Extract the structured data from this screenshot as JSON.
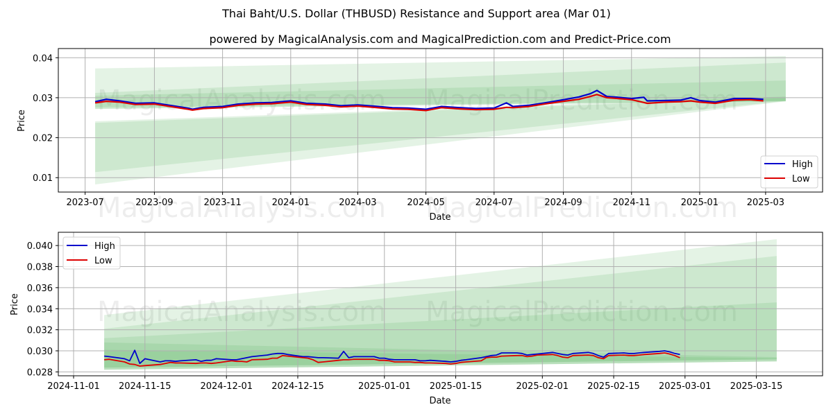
{
  "figure": {
    "title": "Thai Baht/U.S. Dollar (THBUSD) Resistance and Support area (Mar 01)",
    "subtitle": "powered by MagicalAnalysis.com and MagicalPrediction.com and Predict-Price.com",
    "watermarks": [
      "MagicalAnalysis.com",
      "MagicalPrediction.com"
    ]
  },
  "colors": {
    "high": "#0000cc",
    "low": "#dd0000",
    "band": "#4caf50",
    "grid": "#b0b0b0"
  },
  "chart_data": [
    {
      "type": "line",
      "title": "",
      "xlabel": "Date",
      "ylabel": "Price",
      "x_ticks": [
        "2023-07",
        "2023-09",
        "2023-11",
        "2024-01",
        "2024-03",
        "2024-05",
        "2024-07",
        "2024-09",
        "2024-11",
        "2025-01",
        "2025-03"
      ],
      "x_tick_dates": [
        "2023-07-01",
        "2023-09-01",
        "2023-11-01",
        "2024-01-01",
        "2024-03-01",
        "2024-05-01",
        "2024-07-01",
        "2024-09-01",
        "2024-11-01",
        "2025-01-01",
        "2025-03-01"
      ],
      "y_ticks": [
        "0.01",
        "0.02",
        "0.03",
        "0.04"
      ],
      "y_tick_values": [
        0.01,
        0.02,
        0.03,
        0.04
      ],
      "xlim": [
        "2023-06-07",
        "2025-04-21"
      ],
      "ylim": [
        0.0064,
        0.0423
      ],
      "grid": true,
      "legend": {
        "position": "lower-right",
        "entries": [
          "High",
          "Low"
        ]
      },
      "series": [
        {
          "name": "High",
          "x": [
            "2023-07-10",
            "2023-07-20",
            "2023-08-01",
            "2023-08-15",
            "2023-09-01",
            "2023-09-15",
            "2023-10-01",
            "2023-10-05",
            "2023-10-15",
            "2023-11-01",
            "2023-11-15",
            "2023-12-01",
            "2023-12-15",
            "2024-01-01",
            "2024-01-15",
            "2024-02-01",
            "2024-02-15",
            "2024-03-01",
            "2024-03-15",
            "2024-04-01",
            "2024-04-15",
            "2024-05-01",
            "2024-05-15",
            "2024-06-01",
            "2024-06-15",
            "2024-07-01",
            "2024-07-12",
            "2024-07-18",
            "2024-08-01",
            "2024-08-15",
            "2024-09-01",
            "2024-09-15",
            "2024-09-25",
            "2024-10-01",
            "2024-10-10",
            "2024-10-20",
            "2024-11-01",
            "2024-11-12",
            "2024-11-15",
            "2024-12-01",
            "2024-12-15",
            "2024-12-24",
            "2025-01-01",
            "2025-01-15",
            "2025-02-01",
            "2025-02-15",
            "2025-02-27"
          ],
          "values": [
            0.029,
            0.0296,
            0.0292,
            0.0286,
            0.0287,
            0.0281,
            0.0274,
            0.0271,
            0.0276,
            0.0278,
            0.0284,
            0.0287,
            0.0288,
            0.0292,
            0.0286,
            0.0284,
            0.028,
            0.0282,
            0.0279,
            0.0275,
            0.0274,
            0.0271,
            0.0278,
            0.0275,
            0.0273,
            0.0274,
            0.0287,
            0.0278,
            0.0281,
            0.0287,
            0.0295,
            0.0302,
            0.031,
            0.0318,
            0.0303,
            0.0301,
            0.0298,
            0.0301,
            0.0292,
            0.0293,
            0.0294,
            0.03,
            0.0293,
            0.0289,
            0.0298,
            0.0298,
            0.0296
          ]
        },
        {
          "name": "Low",
          "x": [
            "2023-07-10",
            "2023-07-20",
            "2023-08-01",
            "2023-08-15",
            "2023-09-01",
            "2023-09-15",
            "2023-10-01",
            "2023-10-05",
            "2023-10-15",
            "2023-11-01",
            "2023-11-15",
            "2023-12-01",
            "2023-12-15",
            "2024-01-01",
            "2024-01-15",
            "2024-02-01",
            "2024-02-15",
            "2024-03-01",
            "2024-03-15",
            "2024-04-01",
            "2024-04-15",
            "2024-05-01",
            "2024-05-15",
            "2024-06-01",
            "2024-06-15",
            "2024-07-01",
            "2024-07-12",
            "2024-07-18",
            "2024-08-01",
            "2024-08-15",
            "2024-09-01",
            "2024-09-15",
            "2024-09-25",
            "2024-10-01",
            "2024-10-10",
            "2024-10-20",
            "2024-11-01",
            "2024-11-12",
            "2024-11-15",
            "2024-12-01",
            "2024-12-15",
            "2024-12-24",
            "2025-01-01",
            "2025-01-15",
            "2025-02-01",
            "2025-02-15",
            "2025-02-27"
          ],
          "values": [
            0.0287,
            0.0291,
            0.0289,
            0.0283,
            0.0284,
            0.0278,
            0.0271,
            0.0269,
            0.0273,
            0.0275,
            0.0281,
            0.0284,
            0.0285,
            0.0289,
            0.0283,
            0.0281,
            0.0277,
            0.0279,
            0.0276,
            0.0272,
            0.0271,
            0.0268,
            0.0275,
            0.0272,
            0.027,
            0.0271,
            0.0276,
            0.0275,
            0.0278,
            0.0284,
            0.0291,
            0.0296,
            0.0303,
            0.0308,
            0.03,
            0.0298,
            0.0295,
            0.0288,
            0.0286,
            0.0289,
            0.029,
            0.0292,
            0.0289,
            0.0286,
            0.0294,
            0.0295,
            0.0292
          ]
        }
      ],
      "bands": [
        {
          "name": "resistance-outer",
          "x": [
            "2023-07-10",
            "2025-03-19"
          ],
          "upper": [
            0.0373,
            0.0404
          ],
          "lower": [
            0.0272,
            0.0291
          ],
          "opacity": 0.15
        },
        {
          "name": "resistance-mid",
          "x": [
            "2023-07-10",
            "2025-03-19"
          ],
          "upper": [
            0.0312,
            0.0388
          ],
          "lower": [
            0.0272,
            0.0291
          ],
          "opacity": 0.15
        },
        {
          "name": "resistance-inner",
          "x": [
            "2023-07-10",
            "2025-03-19"
          ],
          "upper": [
            0.0305,
            0.0343
          ],
          "lower": [
            0.0276,
            0.0292
          ],
          "opacity": 0.15
        },
        {
          "name": "support-outer",
          "x": [
            "2023-07-10",
            "2025-03-19"
          ],
          "upper": [
            0.0241,
            0.0303
          ],
          "lower": [
            0.0083,
            0.0291
          ],
          "opacity": 0.15
        },
        {
          "name": "support-inner",
          "x": [
            "2023-07-10",
            "2025-03-19"
          ],
          "upper": [
            0.0237,
            0.03
          ],
          "lower": [
            0.0114,
            0.0292
          ],
          "opacity": 0.15
        }
      ]
    },
    {
      "type": "line",
      "title": "",
      "xlabel": "Date",
      "ylabel": "Price",
      "x_ticks": [
        "2024-11-01",
        "2024-11-15",
        "2024-12-01",
        "2024-12-15",
        "2025-01-01",
        "2025-01-15",
        "2025-02-01",
        "2025-02-15",
        "2025-03-01",
        "2025-03-15"
      ],
      "x_tick_dates": [
        "2024-11-01",
        "2024-11-15",
        "2024-12-01",
        "2024-12-15",
        "2025-01-01",
        "2025-01-15",
        "2025-02-01",
        "2025-02-15",
        "2025-03-01",
        "2025-03-15"
      ],
      "y_ticks": [
        "0.028",
        "0.030",
        "0.032",
        "0.034",
        "0.036",
        "0.038",
        "0.040"
      ],
      "y_tick_values": [
        0.028,
        0.03,
        0.032,
        0.034,
        0.036,
        0.038,
        0.04
      ],
      "xlim": [
        "2024-10-29",
        "2025-03-28"
      ],
      "ylim": [
        0.02763,
        0.04126
      ],
      "grid": true,
      "legend": {
        "position": "upper-left",
        "entries": [
          "High",
          "Low"
        ]
      },
      "series": [
        {
          "name": "High",
          "x": [
            "2024-11-07",
            "2024-11-08",
            "2024-11-11",
            "2024-11-12",
            "2024-11-13",
            "2024-11-14",
            "2024-11-15",
            "2024-11-18",
            "2024-11-19",
            "2024-11-20",
            "2024-11-21",
            "2024-11-22",
            "2024-11-25",
            "2024-11-26",
            "2024-11-27",
            "2024-11-28",
            "2024-11-29",
            "2024-12-02",
            "2024-12-03",
            "2024-12-04",
            "2024-12-05",
            "2024-12-06",
            "2024-12-09",
            "2024-12-10",
            "2024-12-11",
            "2024-12-12",
            "2024-12-13",
            "2024-12-16",
            "2024-12-17",
            "2024-12-18",
            "2024-12-19",
            "2024-12-20",
            "2024-12-23",
            "2024-12-24",
            "2024-12-25",
            "2024-12-26",
            "2024-12-27",
            "2024-12-30",
            "2024-12-31",
            "2025-01-01",
            "2025-01-02",
            "2025-01-03",
            "2025-01-06",
            "2025-01-07",
            "2025-01-08",
            "2025-01-09",
            "2025-01-10",
            "2025-01-13",
            "2025-01-14",
            "2025-01-15",
            "2025-01-16",
            "2025-01-17",
            "2025-01-20",
            "2025-01-21",
            "2025-01-22",
            "2025-01-23",
            "2025-01-24",
            "2025-01-27",
            "2025-01-28",
            "2025-01-29",
            "2025-01-30",
            "2025-01-31",
            "2025-02-03",
            "2025-02-04",
            "2025-02-05",
            "2025-02-06",
            "2025-02-07",
            "2025-02-10",
            "2025-02-11",
            "2025-02-12",
            "2025-02-13",
            "2025-02-14",
            "2025-02-17",
            "2025-02-18",
            "2025-02-19",
            "2025-02-20",
            "2025-02-21",
            "2025-02-24",
            "2025-02-25",
            "2025-02-26",
            "2025-02-27",
            "2025-02-28"
          ],
          "values": [
            0.0295,
            0.02945,
            0.02925,
            0.02905,
            0.03005,
            0.0288,
            0.02925,
            0.02895,
            0.02905,
            0.02905,
            0.029,
            0.02905,
            0.02915,
            0.029,
            0.0291,
            0.0291,
            0.02925,
            0.02915,
            0.02915,
            0.02925,
            0.02935,
            0.02945,
            0.0296,
            0.0297,
            0.02975,
            0.02975,
            0.02965,
            0.02945,
            0.02945,
            0.0294,
            0.02935,
            0.02935,
            0.0293,
            0.02995,
            0.02935,
            0.02945,
            0.02945,
            0.02945,
            0.0293,
            0.0293,
            0.0292,
            0.02915,
            0.02915,
            0.02915,
            0.02905,
            0.02905,
            0.0291,
            0.029,
            0.02895,
            0.029,
            0.0291,
            0.02915,
            0.02935,
            0.02945,
            0.02955,
            0.0296,
            0.0298,
            0.0298,
            0.02975,
            0.0296,
            0.02965,
            0.0297,
            0.02985,
            0.02975,
            0.02965,
            0.0296,
            0.02975,
            0.02985,
            0.02975,
            0.02955,
            0.0294,
            0.02975,
            0.0298,
            0.02975,
            0.02975,
            0.0298,
            0.02985,
            0.02995,
            0.03,
            0.0299,
            0.02975,
            0.02965
          ]
        },
        {
          "name": "Low",
          "x": [
            "2024-11-07",
            "2024-11-08",
            "2024-11-11",
            "2024-11-12",
            "2024-11-13",
            "2024-11-14",
            "2024-11-15",
            "2024-11-18",
            "2024-11-19",
            "2024-11-20",
            "2024-11-21",
            "2024-11-22",
            "2024-11-25",
            "2024-11-26",
            "2024-11-27",
            "2024-11-28",
            "2024-11-29",
            "2024-12-02",
            "2024-12-03",
            "2024-12-04",
            "2024-12-05",
            "2024-12-06",
            "2024-12-09",
            "2024-12-10",
            "2024-12-11",
            "2024-12-12",
            "2024-12-13",
            "2024-12-16",
            "2024-12-17",
            "2024-12-18",
            "2024-12-19",
            "2024-12-20",
            "2024-12-23",
            "2024-12-24",
            "2024-12-25",
            "2024-12-26",
            "2024-12-27",
            "2024-12-30",
            "2024-12-31",
            "2025-01-01",
            "2025-01-02",
            "2025-01-03",
            "2025-01-06",
            "2025-01-07",
            "2025-01-08",
            "2025-01-09",
            "2025-01-10",
            "2025-01-13",
            "2025-01-14",
            "2025-01-15",
            "2025-01-16",
            "2025-01-17",
            "2025-01-20",
            "2025-01-21",
            "2025-01-22",
            "2025-01-23",
            "2025-01-24",
            "2025-01-27",
            "2025-01-28",
            "2025-01-29",
            "2025-01-30",
            "2025-01-31",
            "2025-02-03",
            "2025-02-04",
            "2025-02-05",
            "2025-02-06",
            "2025-02-07",
            "2025-02-10",
            "2025-02-11",
            "2025-02-12",
            "2025-02-13",
            "2025-02-14",
            "2025-02-17",
            "2025-02-18",
            "2025-02-19",
            "2025-02-20",
            "2025-02-21",
            "2025-02-24",
            "2025-02-25",
            "2025-02-26",
            "2025-02-27",
            "2025-02-28"
          ],
          "values": [
            0.02915,
            0.0292,
            0.02895,
            0.02875,
            0.0287,
            0.02855,
            0.0286,
            0.0287,
            0.0288,
            0.0289,
            0.02885,
            0.02885,
            0.0288,
            0.02885,
            0.02885,
            0.0288,
            0.02885,
            0.02905,
            0.029,
            0.029,
            0.02895,
            0.02915,
            0.0292,
            0.0293,
            0.0293,
            0.02955,
            0.0295,
            0.02935,
            0.0293,
            0.02915,
            0.0289,
            0.02895,
            0.0291,
            0.02915,
            0.02915,
            0.0292,
            0.0292,
            0.0292,
            0.0291,
            0.0291,
            0.02905,
            0.02895,
            0.02895,
            0.0289,
            0.0289,
            0.02885,
            0.02885,
            0.0288,
            0.02875,
            0.0288,
            0.0289,
            0.02895,
            0.02905,
            0.02935,
            0.0294,
            0.0294,
            0.0295,
            0.02955,
            0.02955,
            0.02945,
            0.0295,
            0.0296,
            0.02965,
            0.02955,
            0.0294,
            0.02935,
            0.02955,
            0.0296,
            0.02955,
            0.02935,
            0.02925,
            0.02955,
            0.0296,
            0.02955,
            0.02955,
            0.0296,
            0.02965,
            0.02975,
            0.0298,
            0.0297,
            0.02955,
            0.02935
          ]
        }
      ],
      "bands": [
        {
          "name": "resistance-outer",
          "x": [
            "2024-11-07",
            "2025-03-19"
          ],
          "upper": [
            0.0334,
            0.0406
          ],
          "lower": [
            0.0282,
            0.029
          ],
          "opacity": 0.15
        },
        {
          "name": "resistance-mid",
          "x": [
            "2024-11-07",
            "2025-03-19"
          ],
          "upper": [
            0.0321,
            0.039
          ],
          "lower": [
            0.0282,
            0.029
          ],
          "opacity": 0.15
        },
        {
          "name": "resistance-inner",
          "x": [
            "2024-11-07",
            "2025-03-19"
          ],
          "upper": [
            0.0312,
            0.0346
          ],
          "lower": [
            0.0284,
            0.0292
          ],
          "opacity": 0.15
        },
        {
          "name": "support-outer",
          "x": [
            "2024-11-07",
            "2025-03-19"
          ],
          "upper": [
            0.0308,
            0.0294
          ],
          "lower": [
            0.0282,
            0.029
          ],
          "opacity": 0.15
        },
        {
          "name": "support-inner",
          "x": [
            "2024-11-07",
            "2025-03-19"
          ],
          "upper": [
            0.0301,
            0.0293
          ],
          "lower": [
            0.0284,
            0.0292
          ],
          "opacity": 0.15
        }
      ]
    }
  ]
}
